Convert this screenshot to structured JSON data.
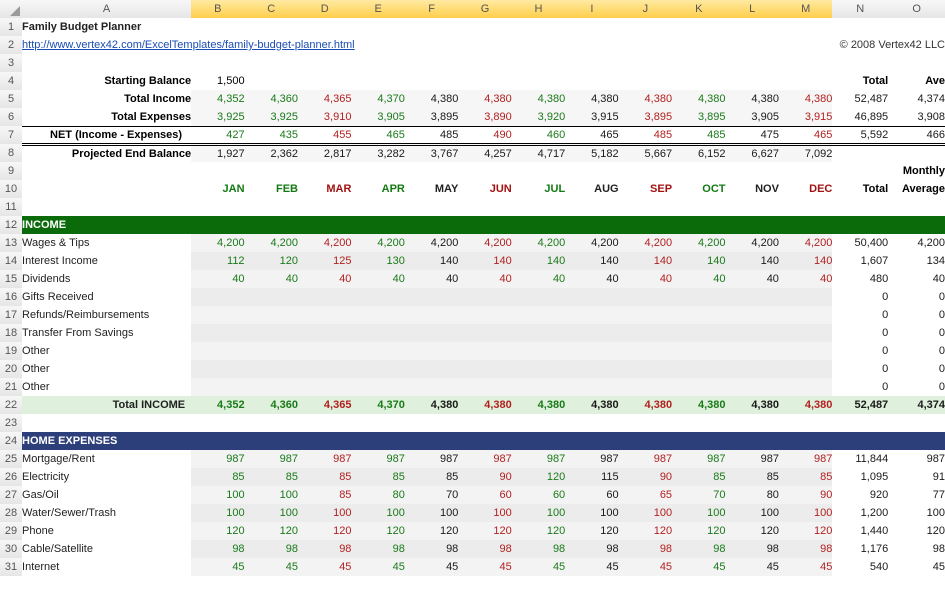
{
  "columns": [
    "A",
    "B",
    "C",
    "D",
    "E",
    "F",
    "G",
    "H",
    "I",
    "J",
    "K",
    "L",
    "M",
    "N",
    "O"
  ],
  "rows": [
    "1",
    "2",
    "3",
    "4",
    "5",
    "6",
    "7",
    "8",
    "9",
    "10",
    "11",
    "12",
    "13",
    "14",
    "15",
    "16",
    "17",
    "18",
    "19",
    "20",
    "21",
    "22",
    "23",
    "24",
    "25",
    "26",
    "27",
    "28",
    "29",
    "30",
    "31"
  ],
  "title": "Family Budget Planner",
  "link": "http://www.vertex42.com/ExcelTemplates/family-budget-planner.html",
  "copyright": "© 2008 Vertex42 LLC",
  "startingBalanceLabel": "Starting Balance",
  "startingBalance": "1,500",
  "totalsHeader": {
    "total": "Total",
    "ave": "Ave",
    "monthly": "Monthly",
    "average": "Average"
  },
  "months": [
    {
      "label": "JAN",
      "cls": "g"
    },
    {
      "label": "FEB",
      "cls": "g"
    },
    {
      "label": "MAR",
      "cls": "r"
    },
    {
      "label": "APR",
      "cls": "g"
    },
    {
      "label": "MAY",
      "cls": "k"
    },
    {
      "label": "JUN",
      "cls": "r"
    },
    {
      "label": "JUL",
      "cls": "g"
    },
    {
      "label": "AUG",
      "cls": "k"
    },
    {
      "label": "SEP",
      "cls": "r"
    },
    {
      "label": "OCT",
      "cls": "g"
    },
    {
      "label": "NOV",
      "cls": "k"
    },
    {
      "label": "DEC",
      "cls": "r"
    }
  ],
  "monthPattern": [
    "green",
    "green",
    "red",
    "green",
    "black",
    "red",
    "green",
    "black",
    "red",
    "green",
    "black",
    "red"
  ],
  "summary": {
    "totalIncome": {
      "label": "Total Income",
      "values": [
        "4,352",
        "4,360",
        "4,365",
        "4,370",
        "4,380",
        "4,380",
        "4,380",
        "4,380",
        "4,380",
        "4,380",
        "4,380",
        "4,380"
      ],
      "total": "52,487",
      "ave": "4,374"
    },
    "totalExpenses": {
      "label": "Total Expenses",
      "values": [
        "3,925",
        "3,925",
        "3,910",
        "3,905",
        "3,895",
        "3,890",
        "3,920",
        "3,915",
        "3,895",
        "3,895",
        "3,905",
        "3,915"
      ],
      "total": "46,895",
      "ave": "3,908"
    },
    "net": {
      "label": "NET (Income - Expenses)",
      "values": [
        "427",
        "435",
        "455",
        "465",
        "485",
        "490",
        "460",
        "465",
        "485",
        "485",
        "475",
        "465"
      ],
      "total": "5,592",
      "ave": "466"
    },
    "projectedEnd": {
      "label": "Projected End Balance",
      "values": [
        "1,927",
        "2,362",
        "2,817",
        "3,282",
        "3,767",
        "4,257",
        "4,717",
        "5,182",
        "5,667",
        "6,152",
        "6,627",
        "7,092"
      ],
      "total": "",
      "ave": ""
    }
  },
  "incomeSection": {
    "header": "INCOME",
    "rows": [
      {
        "label": "Wages & Tips",
        "values": [
          "4,200",
          "4,200",
          "4,200",
          "4,200",
          "4,200",
          "4,200",
          "4,200",
          "4,200",
          "4,200",
          "4,200",
          "4,200",
          "4,200"
        ],
        "total": "50,400",
        "ave": "4,200"
      },
      {
        "label": "Interest Income",
        "values": [
          "112",
          "120",
          "125",
          "130",
          "140",
          "140",
          "140",
          "140",
          "140",
          "140",
          "140",
          "140"
        ],
        "total": "1,607",
        "ave": "134"
      },
      {
        "label": "Dividends",
        "values": [
          "40",
          "40",
          "40",
          "40",
          "40",
          "40",
          "40",
          "40",
          "40",
          "40",
          "40",
          "40"
        ],
        "total": "480",
        "ave": "40"
      },
      {
        "label": "Gifts Received",
        "values": [
          "",
          "",
          "",
          "",
          "",
          "",
          "",
          "",
          "",
          "",
          "",
          ""
        ],
        "total": "0",
        "ave": "0"
      },
      {
        "label": "Refunds/Reimbursements",
        "values": [
          "",
          "",
          "",
          "",
          "",
          "",
          "",
          "",
          "",
          "",
          "",
          ""
        ],
        "total": "0",
        "ave": "0"
      },
      {
        "label": "Transfer From Savings",
        "values": [
          "",
          "",
          "",
          "",
          "",
          "",
          "",
          "",
          "",
          "",
          "",
          ""
        ],
        "total": "0",
        "ave": "0"
      },
      {
        "label": "Other",
        "values": [
          "",
          "",
          "",
          "",
          "",
          "",
          "",
          "",
          "",
          "",
          "",
          ""
        ],
        "total": "0",
        "ave": "0"
      },
      {
        "label": "Other",
        "values": [
          "",
          "",
          "",
          "",
          "",
          "",
          "",
          "",
          "",
          "",
          "",
          ""
        ],
        "total": "0",
        "ave": "0"
      },
      {
        "label": "Other",
        "values": [
          "",
          "",
          "",
          "",
          "",
          "",
          "",
          "",
          "",
          "",
          "",
          ""
        ],
        "total": "0",
        "ave": "0"
      }
    ],
    "subtotal": {
      "label": "Total INCOME",
      "values": [
        "4,352",
        "4,360",
        "4,365",
        "4,370",
        "4,380",
        "4,380",
        "4,380",
        "4,380",
        "4,380",
        "4,380",
        "4,380",
        "4,380"
      ],
      "total": "52,487",
      "ave": "4,374"
    }
  },
  "homeSection": {
    "header": "HOME EXPENSES",
    "rows": [
      {
        "label": "Mortgage/Rent",
        "values": [
          "987",
          "987",
          "987",
          "987",
          "987",
          "987",
          "987",
          "987",
          "987",
          "987",
          "987",
          "987"
        ],
        "total": "11,844",
        "ave": "987"
      },
      {
        "label": "Electricity",
        "values": [
          "85",
          "85",
          "85",
          "85",
          "85",
          "90",
          "120",
          "115",
          "90",
          "85",
          "85",
          "85"
        ],
        "total": "1,095",
        "ave": "91"
      },
      {
        "label": "Gas/Oil",
        "values": [
          "100",
          "100",
          "85",
          "80",
          "70",
          "60",
          "60",
          "60",
          "65",
          "70",
          "80",
          "90"
        ],
        "total": "920",
        "ave": "77"
      },
      {
        "label": "Water/Sewer/Trash",
        "values": [
          "100",
          "100",
          "100",
          "100",
          "100",
          "100",
          "100",
          "100",
          "100",
          "100",
          "100",
          "100"
        ],
        "total": "1,200",
        "ave": "100"
      },
      {
        "label": "Phone",
        "values": [
          "120",
          "120",
          "120",
          "120",
          "120",
          "120",
          "120",
          "120",
          "120",
          "120",
          "120",
          "120"
        ],
        "total": "1,440",
        "ave": "120"
      },
      {
        "label": "Cable/Satellite",
        "values": [
          "98",
          "98",
          "98",
          "98",
          "98",
          "98",
          "98",
          "98",
          "98",
          "98",
          "98",
          "98"
        ],
        "total": "1,176",
        "ave": "98"
      },
      {
        "label": "Internet",
        "values": [
          "45",
          "45",
          "45",
          "45",
          "45",
          "45",
          "45",
          "45",
          "45",
          "45",
          "45",
          "45"
        ],
        "total": "540",
        "ave": "45"
      }
    ]
  }
}
